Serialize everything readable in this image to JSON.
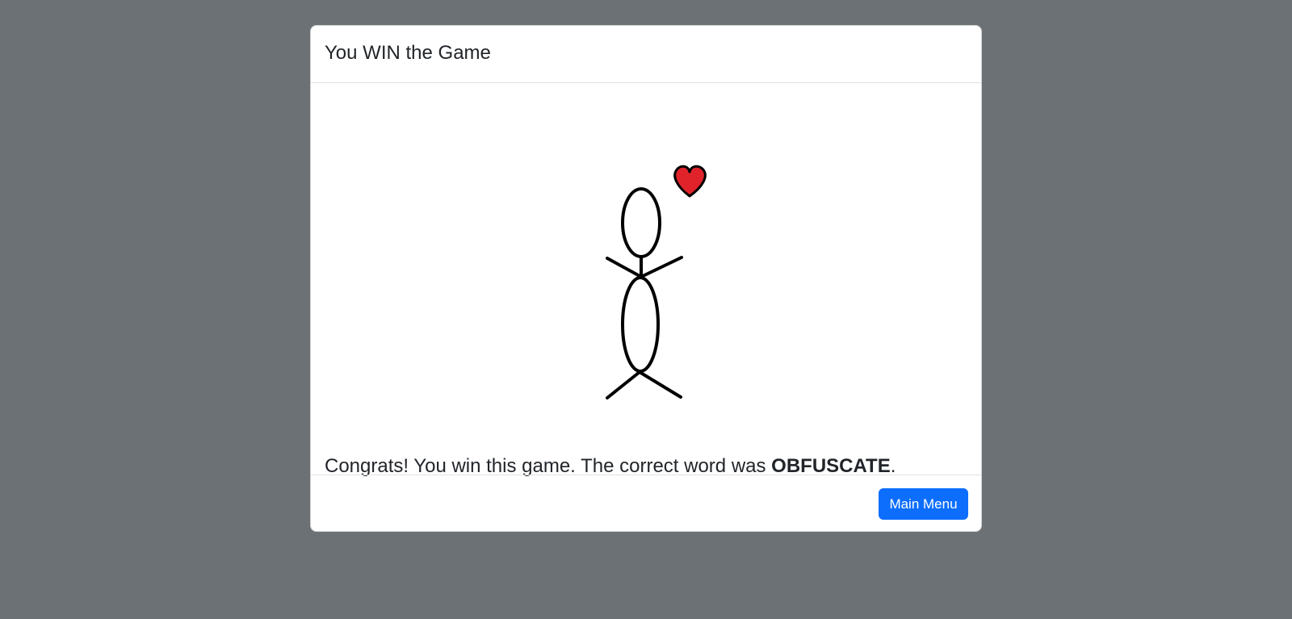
{
  "modal": {
    "title": "You WIN the Game",
    "message_prefix": "Congrats! You win this game. The correct word was ",
    "answer_word": "OBFUSCATE",
    "message_suffix": ".",
    "main_menu_label": "Main Menu"
  },
  "figure": {
    "description_icon": "stick-figure-with-heart-icon",
    "heart_color": "#e0232b",
    "stroke_color": "#000000"
  },
  "colors": {
    "backdrop": "#6c7175",
    "accent": "#0d6efd"
  }
}
